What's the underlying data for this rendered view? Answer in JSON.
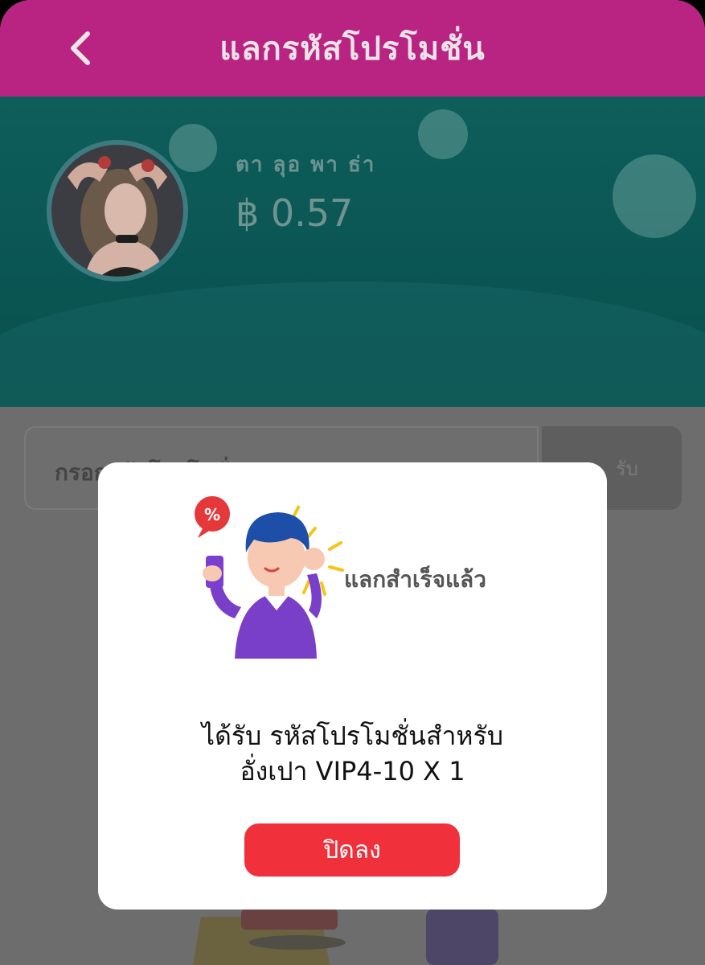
{
  "header": {
    "title": "แลกรหัสโปรโมชั่น",
    "back_icon": "chevron-left-icon"
  },
  "profile": {
    "name": "ตา ลุอ พา ธ่า",
    "balance": "฿ 0.57"
  },
  "promo": {
    "placeholder": "กรอกรหัสโปรโมชั่นของคุณ",
    "submit_label": "รับ"
  },
  "modal": {
    "status": "แลกสำเร็จแล้ว",
    "message_line1": "ได้รับ รหัสโปรโมชั่นสำหรับ",
    "message_line2": "อั่งเปา VIP4-10 X 1",
    "close_label": "ปิดลง"
  },
  "colors": {
    "header": "#b92482",
    "banner": "#0e5e5c",
    "close_button": "#f0303a"
  }
}
